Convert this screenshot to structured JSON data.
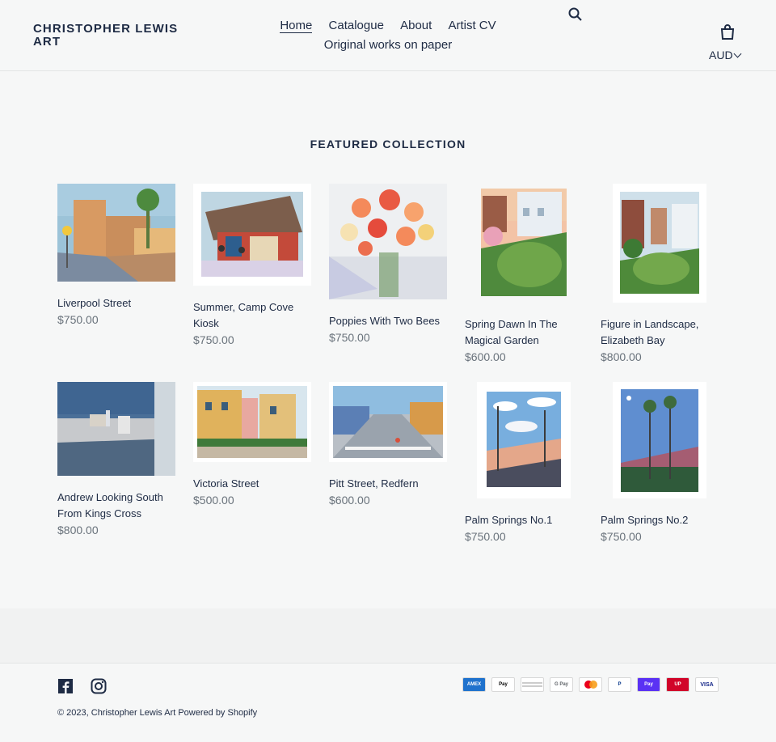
{
  "brand": {
    "name": "CHRISTOPHER LEWIS ART"
  },
  "nav": {
    "items": [
      "Home",
      "Catalogue",
      "About",
      "Artist CV",
      "Original works on paper"
    ]
  },
  "header": {
    "currency": "AUD"
  },
  "main": {
    "section_title": "FEATURED COLLECTION"
  },
  "products": [
    {
      "title": "Liverpool Street",
      "price": "$750.00"
    },
    {
      "title": "Summer, Camp Cove Kiosk",
      "price": "$750.00"
    },
    {
      "title": "Poppies With Two Bees",
      "price": "$750.00"
    },
    {
      "title": "Spring Dawn In The Magical Garden",
      "price": "$600.00"
    },
    {
      "title": "Figure in Landscape, Elizabeth Bay",
      "price": "$800.00"
    },
    {
      "title": "Andrew Looking South From Kings Cross",
      "price": "$800.00"
    },
    {
      "title": "Victoria Street",
      "price": "$500.00"
    },
    {
      "title": "Pitt Street, Redfern",
      "price": "$600.00"
    },
    {
      "title": "Palm Springs No.1",
      "price": "$750.00"
    },
    {
      "title": "Palm Springs No.2",
      "price": "$750.00"
    }
  ],
  "footer": {
    "copyright": "© 2023, Christopher Lewis Art Powered by Shopify",
    "payments": [
      "American Express",
      "Apple Pay",
      "Diners Club",
      "Google Pay",
      "Mastercard",
      "PayPal",
      "Shop Pay",
      "Union Pay",
      "Visa"
    ],
    "social": [
      "facebook-icon",
      "instagram-icon"
    ]
  },
  "colors": {
    "text": "#1e2b44",
    "price": "#69727b",
    "background": "#f6f7f7"
  }
}
